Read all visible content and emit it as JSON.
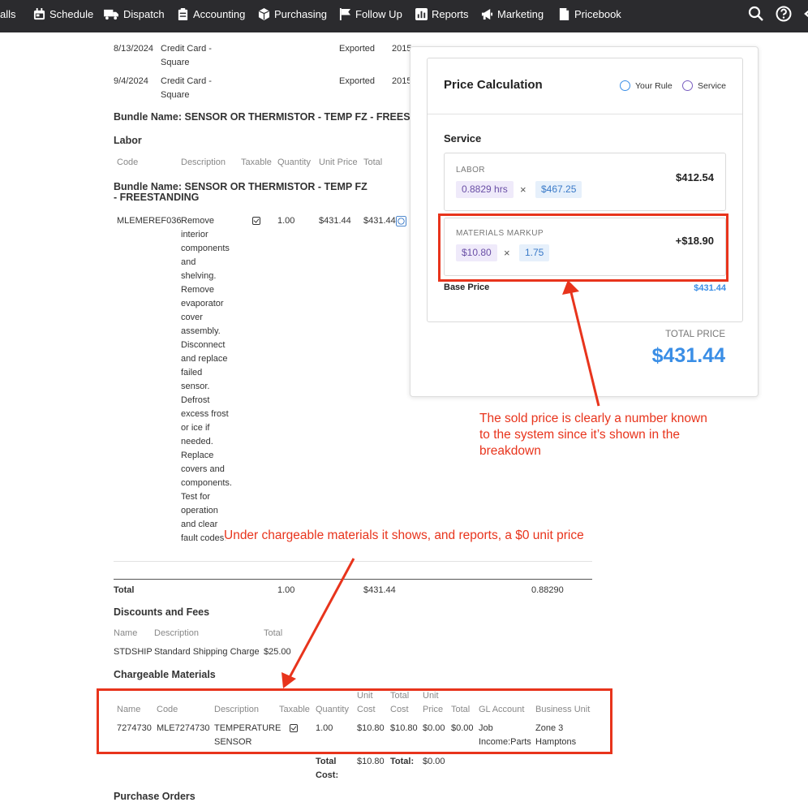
{
  "nav": {
    "calls": "alls",
    "schedule": "Schedule",
    "dispatch": "Dispatch",
    "accounting": "Accounting",
    "purchasing": "Purchasing",
    "follow_up": "Follow Up",
    "reports": "Reports",
    "marketing": "Marketing",
    "pricebook": "Pricebook"
  },
  "payments": [
    {
      "date": "8/13/2024",
      "type_line1": "Credit Card -",
      "type_line2": "Square",
      "status": "Exported",
      "amount": "2015"
    },
    {
      "date": "9/4/2024",
      "type_line1": "Credit Card -",
      "type_line2": "Square",
      "status": "Exported",
      "amount": "2015"
    }
  ],
  "bundle": {
    "heading": "Bundle Name: SENSOR OR THERMISTOR - TEMP FZ - FREESTAN",
    "section": "Labor",
    "cols": {
      "code": "Code",
      "description": "Description",
      "taxable": "Taxable",
      "quantity": "Quantity",
      "unit_price": "Unit Price",
      "total": "Total"
    },
    "sub_heading_line1": "Bundle Name: SENSOR OR THERMISTOR - TEMP FZ",
    "sub_heading_line2": "- FREESTANDING",
    "row": {
      "code": "MLEMEREF036",
      "description": [
        "Remove",
        "interior",
        "components",
        "and",
        "shelving.",
        "Remove",
        "evaporator",
        "cover",
        "assembly.",
        "Disconnect",
        "and replace",
        "failed",
        "sensor.",
        "Defrost",
        "excess frost",
        "or ice if",
        "needed.",
        "Replace",
        "covers and",
        "components.",
        "Test for",
        "operation",
        "and clear",
        "fault codes."
      ],
      "taxable": true,
      "quantity": "1.00",
      "unit_price": "$431.44",
      "total": "$431.44"
    },
    "total_label": "Total",
    "total_qty": "1.00",
    "total_amount": "$431.44",
    "total_hours": "0.88290"
  },
  "discounts": {
    "heading": "Discounts and Fees",
    "cols": {
      "name": "Name",
      "description": "Description",
      "total": "Total"
    },
    "row": {
      "name": "STDSHIP",
      "description": "Standard Shipping Charge",
      "total": "$25.00"
    }
  },
  "materials": {
    "heading": "Chargeable Materials",
    "cols": {
      "name": "Name",
      "code": "Code",
      "description": "Description",
      "taxable": "Taxable",
      "quantity": "Quantity",
      "unit_cost_1": "Unit",
      "unit_cost_2": "Cost",
      "total_cost_1": "Total",
      "total_cost_2": "Cost",
      "unit_price_1": "Unit",
      "unit_price_2": "Price",
      "total": "Total",
      "gl_account": "GL Account",
      "business_unit": "Business Unit"
    },
    "row": {
      "name": "7274730",
      "code": "MLE7274730",
      "desc1": "TEMPERATURE",
      "desc2": "SENSOR",
      "taxable": true,
      "quantity": "1.00",
      "unit_cost": "$10.80",
      "total_cost": "$10.80",
      "unit_price": "$0.00",
      "total": "$0.00",
      "gl1": "Job",
      "gl2": "Income:Parts",
      "bu1": "Zone 3",
      "bu2": "Hamptons"
    },
    "summary": {
      "total_cost_label_1": "Total",
      "total_cost_label_2": "Cost:",
      "total_cost": "$10.80",
      "total_label": "Total:",
      "total": "$0.00"
    }
  },
  "purchase_orders": {
    "heading": "Purchase Orders"
  },
  "price_calc": {
    "title": "Price Calculation",
    "option_your_rule": "Your Rule",
    "option_service": "Service",
    "section": "Service",
    "labor": {
      "label": "LABOR",
      "hours": "0.8829 hrs",
      "times": "×",
      "rate": "$467.25",
      "amount": "$412.54"
    },
    "markup": {
      "label": "MATERIALS MARKUP",
      "cost": "$10.80",
      "times": "×",
      "multiplier": "1.75",
      "amount": "+$18.90"
    },
    "base_price_label": "Base Price",
    "base_price": "$431.44",
    "total_price_label": "TOTAL PRICE",
    "total_price": "$431.44"
  },
  "annotations": {
    "sold_price_note": [
      "The sold price is clearly a number known",
      "to the system since it’s shown in the",
      "breakdown"
    ],
    "materials_note": "Under chargeable materials it shows, and reports, a $0 unit price"
  },
  "colors": {
    "topbar": "#2b2b2e",
    "annotation_red": "#e8341c",
    "accent_blue": "#3a8ee6",
    "tag_purple": "#efeafa"
  }
}
